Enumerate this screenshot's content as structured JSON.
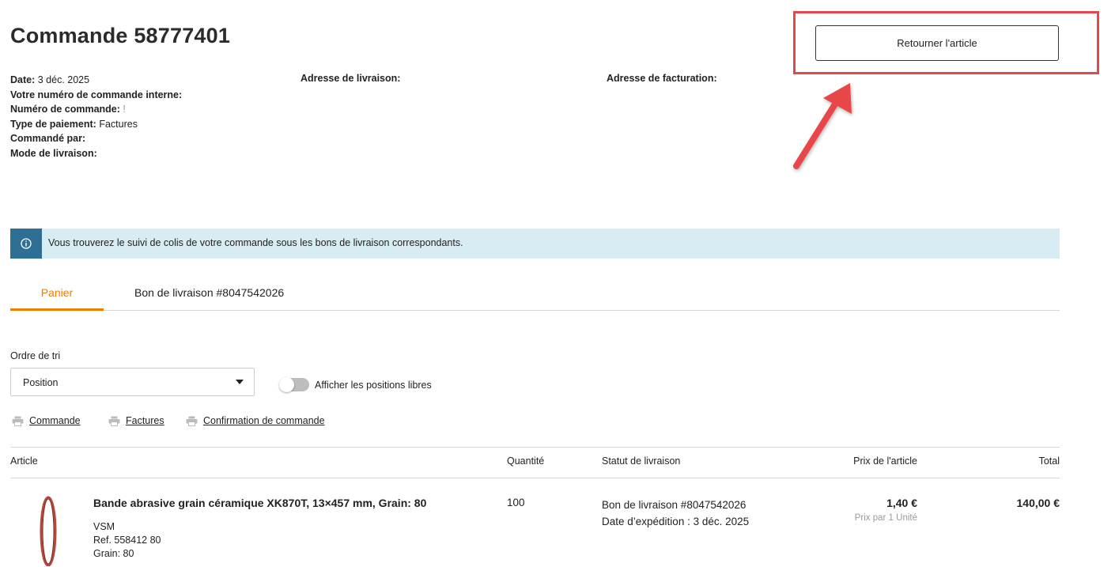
{
  "order": {
    "title": "Commande 58777401",
    "date_label": "Date:",
    "date_value": "3 déc. 2025",
    "internal_number_label": "Votre numéro de commande interne:",
    "order_number_label": "Numéro de commande:",
    "order_number_value": "!",
    "payment_type_label": "Type de paiement:",
    "payment_type_value": "Factures",
    "ordered_by_label": "Commandé par:",
    "delivery_mode_label": "Mode de livraison:",
    "shipping_address_label": "Adresse de livraison:",
    "billing_address_label": "Adresse de facturation:"
  },
  "actions": {
    "return_button": "Retourner l'article",
    "highlight_color": "#e8474a"
  },
  "banner": {
    "text": "Vous trouverez le suivi de colis de votre commande sous les bons de livraison correspondants.",
    "icon": "info-icon",
    "background": "#d8ecf4",
    "icon_background": "#2f6f96"
  },
  "tabs": [
    {
      "label": "Panier",
      "active": true
    },
    {
      "label": "Bon de livraison #8047542026",
      "active": false
    }
  ],
  "accent_color": "#f07d00",
  "sort": {
    "label": "Ordre de tri",
    "selected": "Position"
  },
  "toggle": {
    "label": "Afficher les positions libres",
    "on": false
  },
  "documents": [
    {
      "label": "Commande",
      "icon": "printer-icon"
    },
    {
      "label": "Factures",
      "icon": "printer-icon"
    },
    {
      "label": "Confirmation de commande",
      "icon": "printer-icon"
    }
  ],
  "table": {
    "headers": {
      "article": "Article",
      "quantity": "Quantité",
      "status": "Statut de livraison",
      "price": "Prix de l'article",
      "total": "Total"
    },
    "rows": [
      {
        "name": "Bande abrasive grain céramique XK870T, 13×457 mm, Grain: 80",
        "brand": "VSM",
        "ref": "Ref. 558412 80",
        "grain": "Grain: 80",
        "quantity": "100",
        "status_line1": "Bon de livraison #8047542026",
        "status_line2": "Date d’expédition : 3 déc. 2025",
        "price": "1,40 €",
        "price_unit": "Prix par 1 Unité",
        "total": "140,00 €"
      }
    ]
  }
}
